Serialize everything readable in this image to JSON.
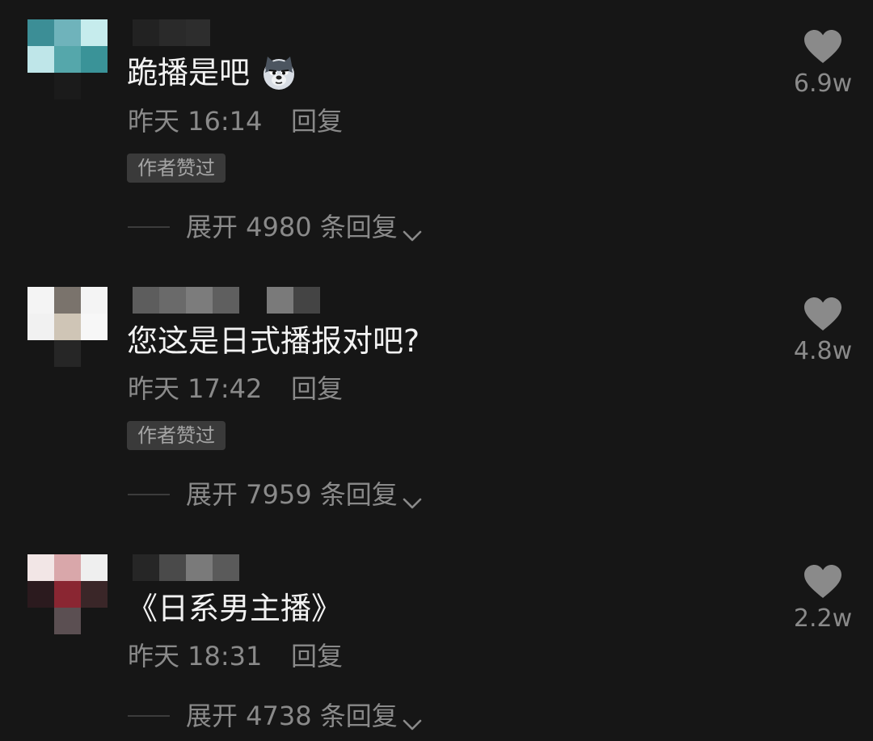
{
  "comments": [
    {
      "text": "跪播是吧",
      "emoji": "husky-dog-emoji",
      "time": "昨天 16:14",
      "reply_label": "回复",
      "badge": "作者赞过",
      "expand_label": "展开 4980 条回复",
      "likes": "6.9w"
    },
    {
      "text": "您这是日式播报对吧?",
      "time": "昨天 17:42",
      "reply_label": "回复",
      "badge": "作者赞过",
      "expand_label": "展开 7959 条回复",
      "likes": "4.8w"
    },
    {
      "text": "《日系男主播》",
      "time": "昨天 18:31",
      "reply_label": "回复",
      "expand_label": "展开 4738 条回复",
      "likes": "2.2w"
    }
  ],
  "icons": {
    "like": "heart-icon",
    "expand": "chevron-down-icon"
  },
  "colors": {
    "background": "#161616",
    "primary_text": "#f2f2f2",
    "secondary_text": "#8a8a8a",
    "badge_bg": "#3a3a3a",
    "heart": "#8a8a8a"
  }
}
